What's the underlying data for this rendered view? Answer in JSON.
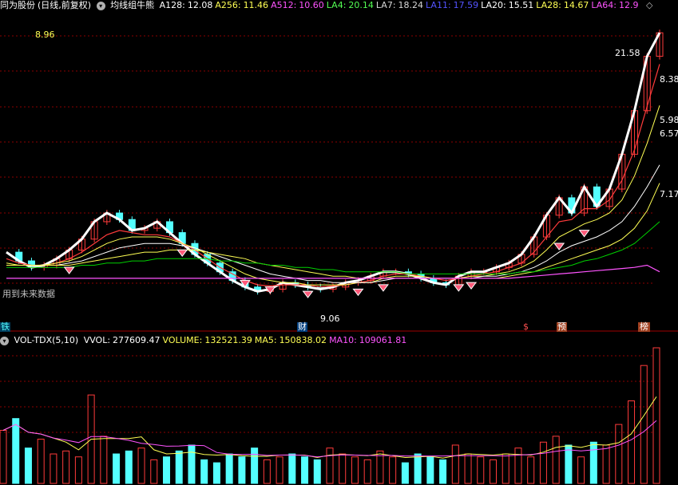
{
  "header": {
    "stock_name": "同为股份",
    "period_label": "(日线,前复权)",
    "indicator_name": "均线组牛熊",
    "items": [
      {
        "label": "A128:",
        "value": "12.08",
        "color": "#ffffff"
      },
      {
        "label": "A256:",
        "value": "11.46",
        "color": "#ffff54"
      },
      {
        "label": "A512:",
        "value": "10.60",
        "color": "#ff54ff"
      },
      {
        "label": "LA4:",
        "value": "20.14",
        "color": "#54ff54"
      },
      {
        "label": "LA7:",
        "value": "18.24",
        "color": "#d8d8d8"
      },
      {
        "label": "LA11:",
        "value": "17.59",
        "color": "#5454ff"
      },
      {
        "label": "LA20:",
        "value": "15.51",
        "color": "#ffffff"
      },
      {
        "label": "LA28:",
        "value": "14.67",
        "color": "#ffff54"
      },
      {
        "label": "LA64:",
        "value": "12.9",
        "color": "#ff54ff"
      }
    ],
    "more_icon": "diamond-icon"
  },
  "price_labels": {
    "high_left": "8.96",
    "high_right": "21.58",
    "low": "9.06",
    "right_a": "8.38",
    "right_b": "5.98",
    "right_c": "6.57",
    "right_d": "7.17"
  },
  "annotations": {
    "future_data": "用到未来数据",
    "left_edge": "铁",
    "finance": "财",
    "dollar": "$",
    "forecast": "预",
    "list": "榜"
  },
  "vol_header": {
    "name": "VOL-TDX(5,10)",
    "items": [
      {
        "label": "VVOL:",
        "value": "277609.47",
        "color": "#ffffff"
      },
      {
        "label": "VOLUME:",
        "value": "132521.39",
        "color": "#ffff54"
      },
      {
        "label": "MA5:",
        "value": "150838.02",
        "color": "#ffff54"
      },
      {
        "label": "MA10:",
        "value": "109061.81",
        "color": "#ff54ff"
      }
    ]
  },
  "colors": {
    "up": "#ff3b3b",
    "down": "#54ffff",
    "grid": "#8b0000",
    "white_line": "#ffffff",
    "yellow_line": "#ffff54",
    "magenta_line": "#ff54ff",
    "green_line": "#00d000",
    "blue_line": "#3c3cff"
  },
  "chart_data": {
    "type": "candlestick",
    "price_range": [
      8.5,
      22.5
    ],
    "series": [
      {
        "values": [
          11.5,
          11.1,
          10.8,
          10.9,
          11.2,
          11.6,
          12.1,
          12.9,
          13.3,
          13.0,
          12.5,
          12.6,
          12.9,
          12.4,
          11.9,
          11.4,
          11.0,
          10.6,
          10.2,
          9.9,
          9.7,
          9.8,
          10.1,
          10.0,
          9.9,
          9.8,
          9.9,
          10.1,
          10.2,
          10.4,
          10.6,
          10.6,
          10.5,
          10.3,
          10.1,
          10.0,
          10.4,
          10.6,
          10.6,
          10.8,
          11.0,
          11.4,
          12.2,
          13.2,
          14.0,
          13.3,
          14.5,
          13.6,
          14.4,
          16.0,
          18.0,
          20.5,
          21.58
        ]
      },
      {
        "values": [
          11.2,
          11.0,
          10.9,
          10.9,
          11.0,
          11.2,
          11.5,
          11.9,
          12.3,
          12.5,
          12.4,
          12.3,
          12.3,
          12.2,
          11.9,
          11.6,
          11.2,
          10.8,
          10.5,
          10.2,
          10.0,
          9.95,
          10.0,
          10.0,
          10.0,
          9.9,
          9.95,
          10.0,
          10.1,
          10.2,
          10.4,
          10.5,
          10.5,
          10.4,
          10.3,
          10.2,
          10.3,
          10.4,
          10.5,
          10.6,
          10.8,
          11.0,
          11.5,
          12.2,
          12.9,
          13.0,
          13.5,
          13.5,
          13.9,
          14.8,
          16.2,
          18.2,
          20.14
        ]
      },
      {
        "values": [
          11.0,
          10.9,
          10.9,
          10.9,
          11.0,
          11.1,
          11.3,
          11.6,
          11.9,
          12.1,
          12.2,
          12.2,
          12.2,
          12.1,
          11.9,
          11.7,
          11.4,
          11.1,
          10.8,
          10.5,
          10.3,
          10.2,
          10.1,
          10.1,
          10.0,
          10.0,
          10.0,
          10.0,
          10.1,
          10.1,
          10.3,
          10.4,
          10.4,
          10.4,
          10.3,
          10.3,
          10.3,
          10.4,
          10.4,
          10.5,
          10.6,
          10.8,
          11.1,
          11.6,
          12.2,
          12.5,
          12.8,
          13.0,
          13.3,
          13.9,
          15.0,
          16.5,
          18.24
        ]
      },
      {
        "values": [
          10.9,
          10.9,
          10.9,
          10.9,
          10.9,
          11.0,
          11.1,
          11.3,
          11.5,
          11.7,
          11.8,
          11.9,
          11.9,
          11.9,
          11.8,
          11.7,
          11.5,
          11.3,
          11.1,
          10.9,
          10.7,
          10.5,
          10.4,
          10.3,
          10.2,
          10.2,
          10.1,
          10.1,
          10.1,
          10.1,
          10.2,
          10.3,
          10.3,
          10.3,
          10.3,
          10.3,
          10.3,
          10.3,
          10.4,
          10.4,
          10.5,
          10.6,
          10.8,
          11.1,
          11.5,
          11.8,
          12.0,
          12.2,
          12.5,
          12.9,
          13.6,
          14.5,
          15.51
        ]
      },
      {
        "values": [
          10.9,
          10.9,
          10.9,
          10.9,
          10.9,
          10.9,
          11.0,
          11.1,
          11.2,
          11.3,
          11.4,
          11.5,
          11.5,
          11.6,
          11.6,
          11.6,
          11.5,
          11.4,
          11.3,
          11.2,
          11.0,
          10.9,
          10.8,
          10.7,
          10.6,
          10.5,
          10.4,
          10.4,
          10.3,
          10.3,
          10.3,
          10.3,
          10.3,
          10.3,
          10.3,
          10.3,
          10.3,
          10.3,
          10.3,
          10.3,
          10.4,
          10.5,
          10.6,
          10.8,
          11.0,
          11.2,
          11.4,
          11.6,
          11.8,
          12.1,
          12.6,
          13.4,
          14.67
        ]
      },
      {
        "values": [
          10.8,
          10.8,
          10.8,
          10.8,
          10.8,
          10.8,
          10.9,
          10.9,
          11.0,
          11.0,
          11.1,
          11.1,
          11.2,
          11.2,
          11.2,
          11.2,
          11.2,
          11.1,
          11.1,
          11.0,
          11.0,
          10.9,
          10.9,
          10.8,
          10.8,
          10.7,
          10.7,
          10.6,
          10.6,
          10.6,
          10.6,
          10.6,
          10.5,
          10.5,
          10.5,
          10.5,
          10.5,
          10.5,
          10.5,
          10.5,
          10.5,
          10.6,
          10.6,
          10.7,
          10.8,
          10.9,
          11.1,
          11.2,
          11.4,
          11.6,
          11.9,
          12.4,
          12.9
        ]
      },
      {
        "values": [
          10.3,
          10.3,
          10.3,
          10.3,
          10.3,
          10.3,
          10.3,
          10.3,
          10.3,
          10.3,
          10.3,
          10.3,
          10.3,
          10.3,
          10.3,
          10.3,
          10.3,
          10.3,
          10.3,
          10.3,
          10.3,
          10.3,
          10.3,
          10.3,
          10.3,
          10.3,
          10.3,
          10.3,
          10.3,
          10.3,
          10.3,
          10.3,
          10.3,
          10.3,
          10.3,
          10.3,
          10.3,
          10.3,
          10.3,
          10.3,
          10.3,
          10.35,
          10.4,
          10.45,
          10.5,
          10.55,
          10.6,
          10.65,
          10.7,
          10.75,
          10.8,
          10.9,
          10.6
        ]
      }
    ],
    "volume": [
      18,
      22,
      12,
      15,
      10,
      11,
      9,
      30,
      16,
      10,
      11,
      12,
      8,
      9,
      11,
      13,
      8,
      7,
      10,
      9,
      12,
      8,
      9,
      10,
      9,
      8,
      12,
      10,
      9,
      8,
      11,
      9,
      7,
      10,
      9,
      8,
      13,
      10,
      9,
      8,
      10,
      12,
      9,
      14,
      16,
      13,
      9,
      14,
      13,
      20,
      28,
      40,
      46
    ]
  }
}
